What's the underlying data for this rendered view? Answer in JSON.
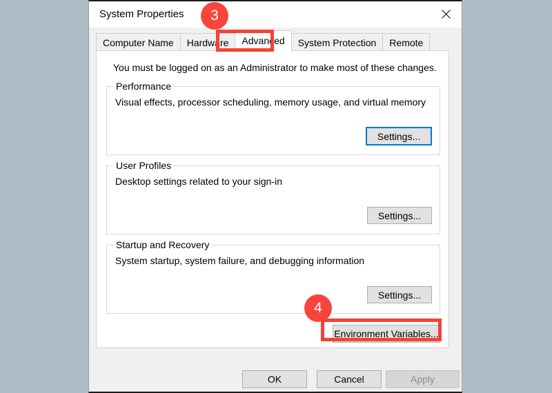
{
  "window": {
    "title": "System Properties",
    "close_icon": "close-icon"
  },
  "tabs": [
    {
      "label": "Computer Name",
      "active": false
    },
    {
      "label": "Hardware",
      "active": false
    },
    {
      "label": "Advanced",
      "active": true
    },
    {
      "label": "System Protection",
      "active": false
    },
    {
      "label": "Remote",
      "active": false
    }
  ],
  "panel": {
    "notice": "You must be logged on as an Administrator to make most of these changes.",
    "groups": [
      {
        "legend": "Performance",
        "description": "Visual effects, processor scheduling, memory usage, and virtual memory",
        "button_label": "Settings..."
      },
      {
        "legend": "User Profiles",
        "description": "Desktop settings related to your sign-in",
        "button_label": "Settings..."
      },
      {
        "legend": "Startup and Recovery",
        "description": "System startup, system failure, and debugging information",
        "button_label": "Settings..."
      }
    ],
    "environment_variables_label": "Environment Variables..."
  },
  "footer": {
    "ok_label": "OK",
    "cancel_label": "Cancel",
    "apply_label": "Apply"
  },
  "annotations": {
    "badge_step_3": "3",
    "badge_step_4": "4",
    "highlight_color": "#f44336",
    "badge_color": "#f7453c",
    "focus_color": "#0078d7"
  }
}
